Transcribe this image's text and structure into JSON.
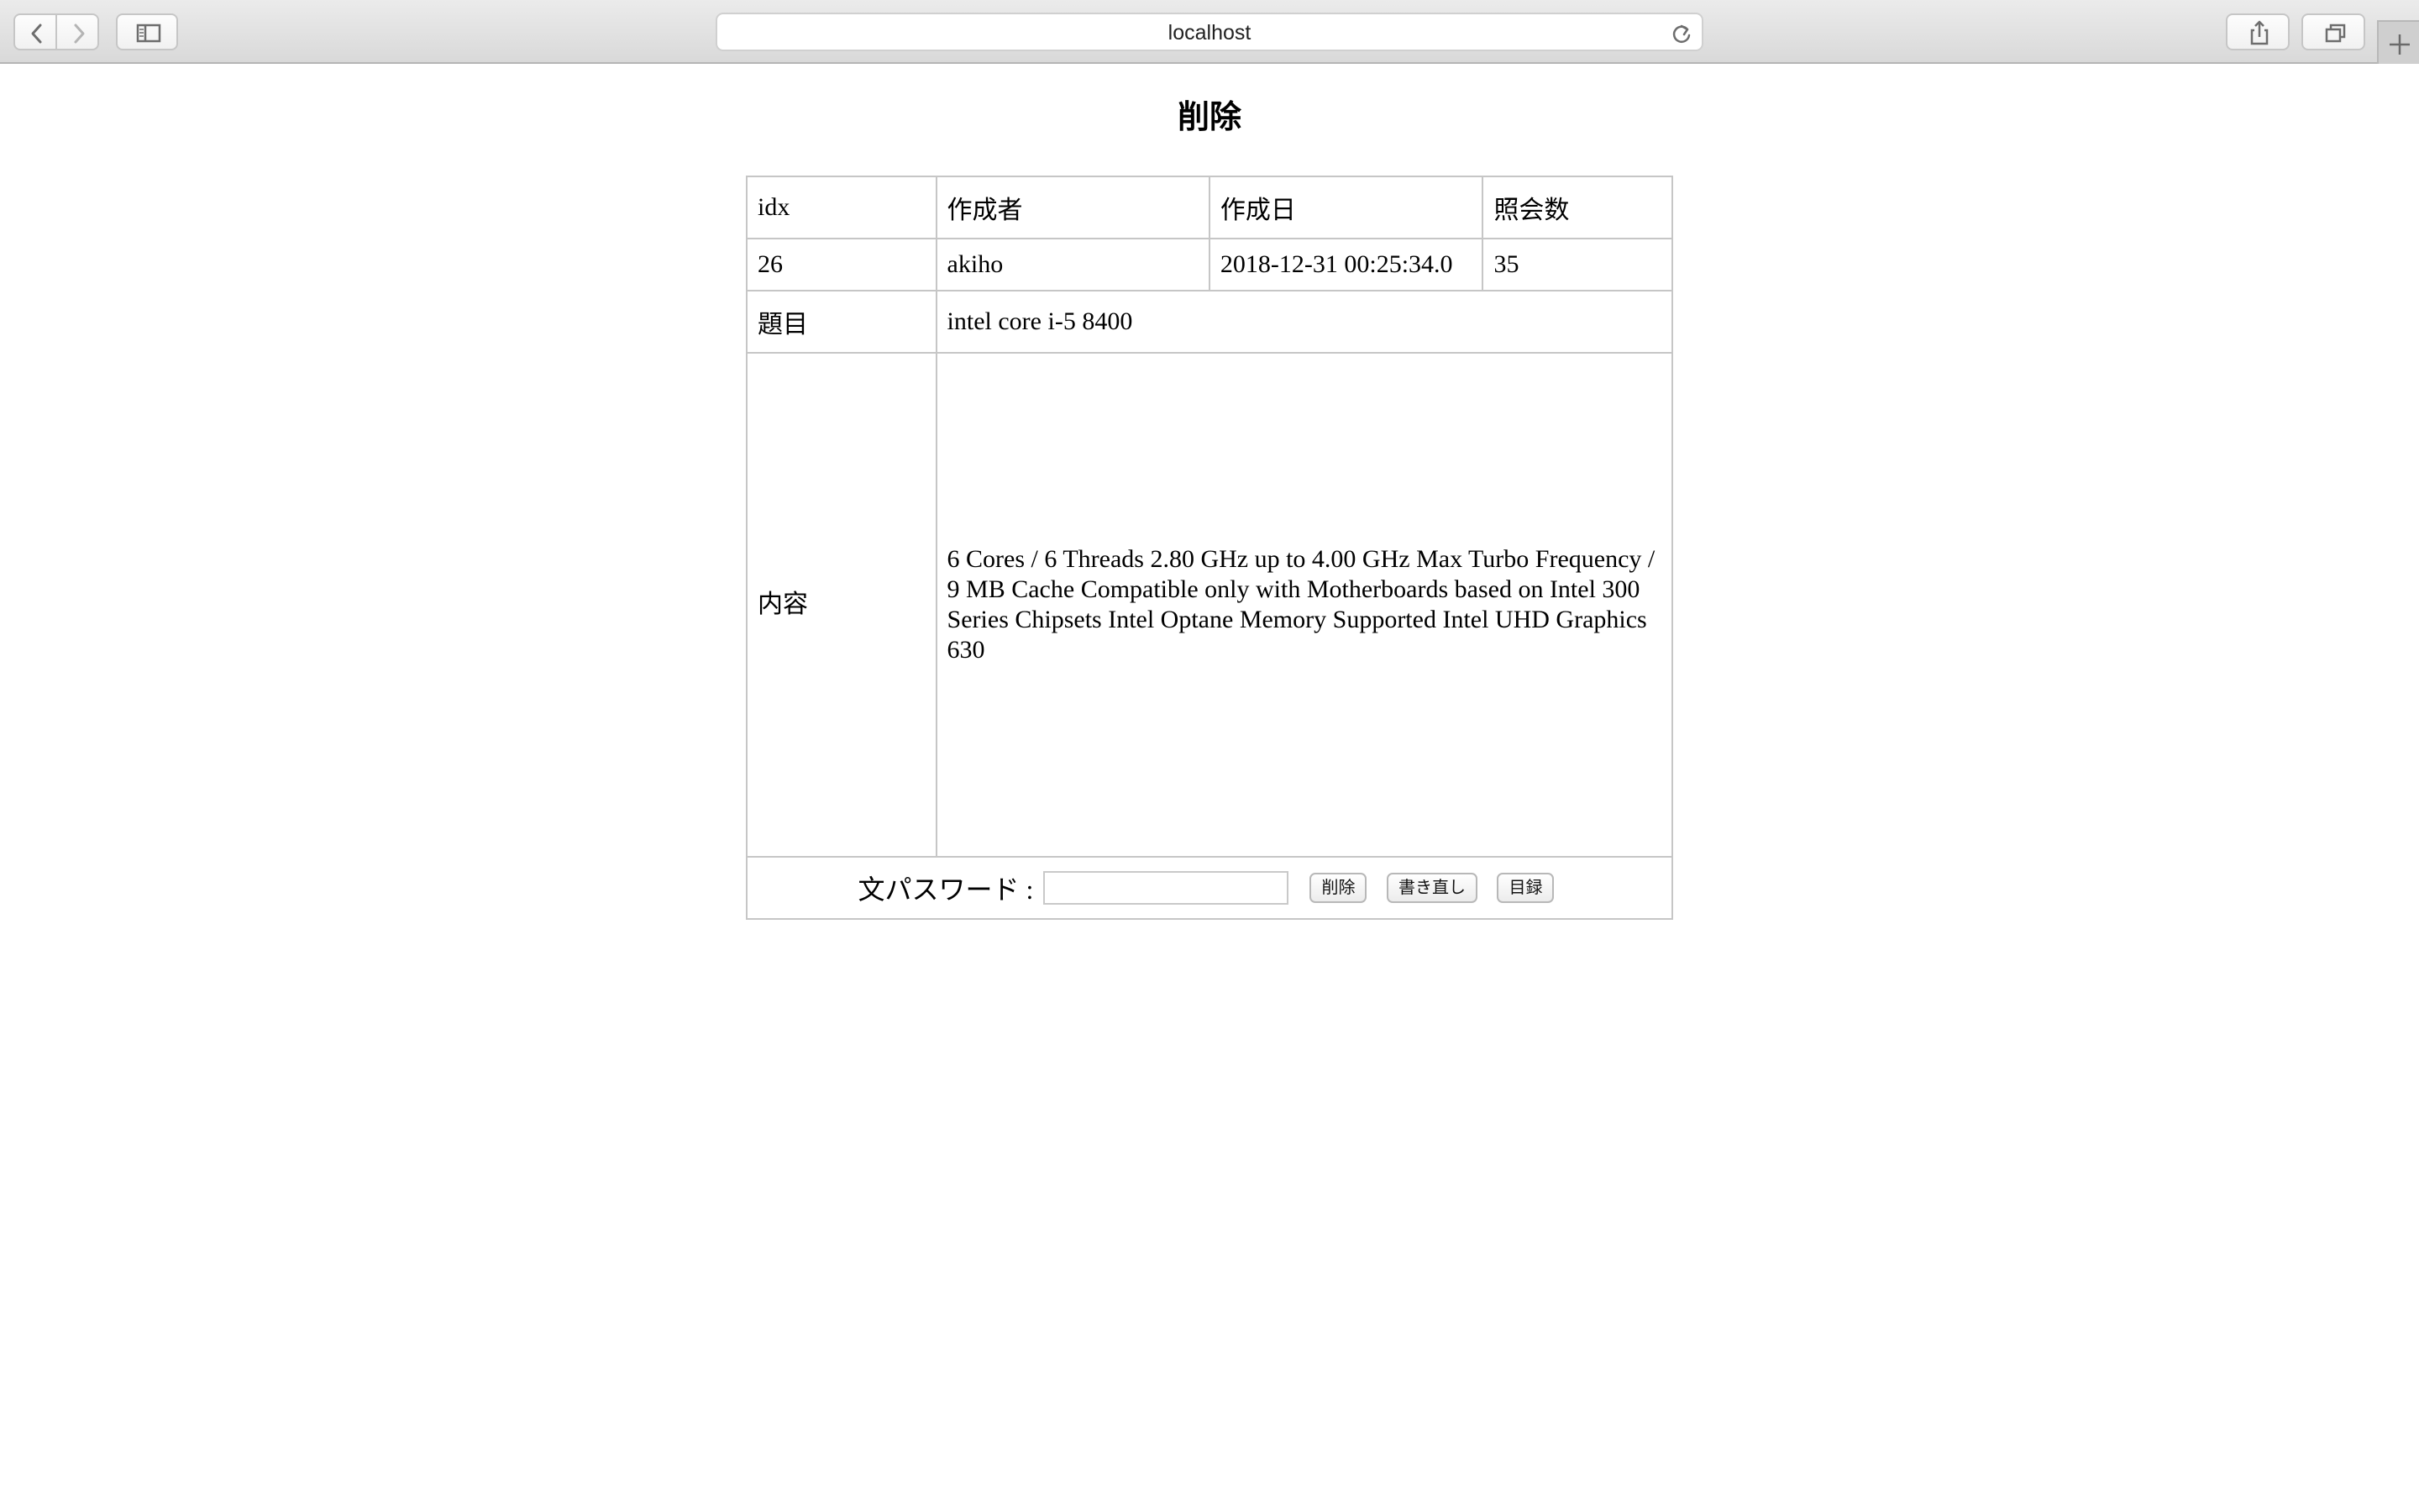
{
  "browser": {
    "url": "localhost"
  },
  "page": {
    "title": "削除"
  },
  "table": {
    "headers": [
      "idx",
      "作成者",
      "作成日",
      "照会数"
    ],
    "row": {
      "idx": "26",
      "author": "akiho",
      "created": "2018-12-31 00:25:34.0",
      "views": "35"
    },
    "subject_label": "題目",
    "subject_value": "intel core i-5 8400",
    "content_label": "内容",
    "content_value": "6 Cores / 6 Threads 2.80 GHz up to 4.00 GHz Max Turbo Frequency / 9 MB Cache Compatible only with Motherboards based on Intel 300 Series Chipsets Intel Optane Memory Supported Intel UHD Graphics 630"
  },
  "form": {
    "password_label": "文パスワード :",
    "password_value": "",
    "delete_button": "削除",
    "rewrite_button": "書き直し",
    "list_button": "目録"
  },
  "icons": {
    "back": "chevron-left-icon",
    "forward": "chevron-right-icon",
    "sidebar": "sidebar-icon",
    "reload": "reload-icon",
    "share": "share-icon",
    "tabs": "tabs-overview-icon",
    "new_tab": "plus-icon"
  }
}
